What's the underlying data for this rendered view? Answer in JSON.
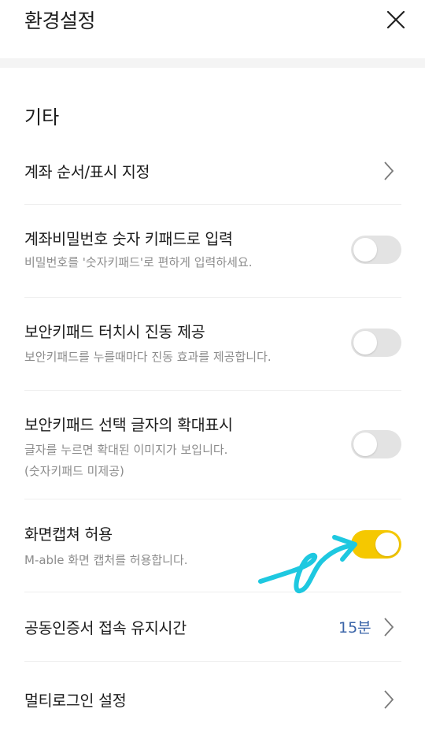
{
  "header": {
    "title": "환경설정"
  },
  "section": {
    "title": "기타"
  },
  "rows": [
    {
      "label": "계좌 순서/표시 지정"
    },
    {
      "label": "계좌비밀번호 숫자 키패드로 입력",
      "desc": "비밀번호를 '숫자키패드'로 편하게 입력하세요.",
      "toggle": "off"
    },
    {
      "label": "보안키패드 터치시 진동 제공",
      "desc": "보안키패드를 누를때마다 진동 효과를 제공합니다.",
      "toggle": "off"
    },
    {
      "label": "보안키패드 선택 글자의 확대표시",
      "desc1": "글자를 누르면 확대된 이미지가 보입니다.",
      "desc2": "(숫자키패드 미제공)",
      "toggle": "off"
    },
    {
      "label": "화면캡쳐 허용",
      "desc": "M-able 화면 캡처를 허용합니다.",
      "toggle": "on"
    },
    {
      "label": "공동인증서 접속 유지시간",
      "value": "15분"
    },
    {
      "label": "멀티로그인 설정"
    }
  ],
  "colors": {
    "toggle_on": "#f5c800",
    "toggle_off": "#e3e3e3",
    "value_text": "#3a64a8",
    "annotation": "#1ec8e0"
  },
  "icons": {
    "close": "close-icon",
    "chevron": "chevron-right-icon",
    "annotation": "hand-drawn-arrow"
  }
}
